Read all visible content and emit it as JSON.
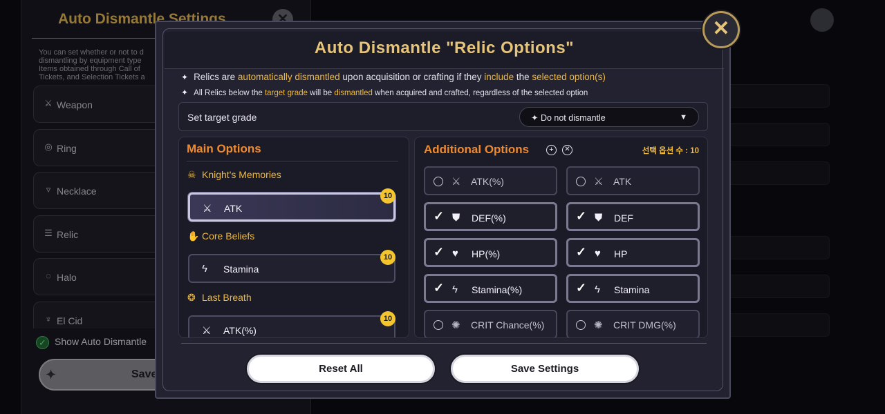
{
  "background": {
    "title": "Auto Dismantle Settings",
    "description": "You can set whether or not to d\ndismantling by equipment type\nItems obtained through Call of\nTickets, and Selection Tickets a",
    "items": [
      {
        "label": "Weapon",
        "icon": "sword-icon"
      },
      {
        "label": "Ring",
        "icon": "ring-icon"
      },
      {
        "label": "Necklace",
        "icon": "necklace-icon"
      },
      {
        "label": "Relic",
        "icon": "relic-icon"
      },
      {
        "label": "Halo",
        "icon": "halo-icon"
      },
      {
        "label": "El Cid",
        "icon": "el-cid-icon"
      }
    ],
    "show_label": "Show Auto Dismantle",
    "save_label": "Save"
  },
  "modal": {
    "title": "Auto Dismantle \"Relic Options\"",
    "info1": {
      "a": "Relics are ",
      "b": "automatically dismantled",
      "c": " upon acquisition or crafting if they ",
      "d": "include",
      "e": " the ",
      "f": "selected option(s)"
    },
    "info2": {
      "a": "All Relics below the ",
      "b": "target grade",
      "c": " will be ",
      "d": "dismantled",
      "e": " when acquired and crafted, regardless of the selected option"
    },
    "grade_label": "Set target grade",
    "grade_value": "Do not dismantle",
    "main": {
      "title": "Main Options",
      "sections": [
        {
          "label": "Knight's Memories",
          "option": "ATK",
          "badge": "10",
          "selected": true
        },
        {
          "label": "Core Beliefs",
          "option": "Stamina",
          "badge": "10",
          "selected": false
        },
        {
          "label": "Last Breath",
          "option": "ATK(%)",
          "badge": "10",
          "selected": false
        }
      ]
    },
    "additional": {
      "title": "Additional Options",
      "count_label": "선택 옵션 수 : 10",
      "options": [
        {
          "label": "ATK(%)",
          "checked": false
        },
        {
          "label": "ATK",
          "checked": false
        },
        {
          "label": "DEF(%)",
          "checked": true
        },
        {
          "label": "DEF",
          "checked": true
        },
        {
          "label": "HP(%)",
          "checked": true
        },
        {
          "label": "HP",
          "checked": true
        },
        {
          "label": "Stamina(%)",
          "checked": true
        },
        {
          "label": "Stamina",
          "checked": true
        },
        {
          "label": "CRIT Chance(%)",
          "checked": false
        },
        {
          "label": "CRIT DMG(%)",
          "checked": false
        }
      ]
    },
    "reset_label": "Reset All",
    "save_label": "Save Settings"
  }
}
